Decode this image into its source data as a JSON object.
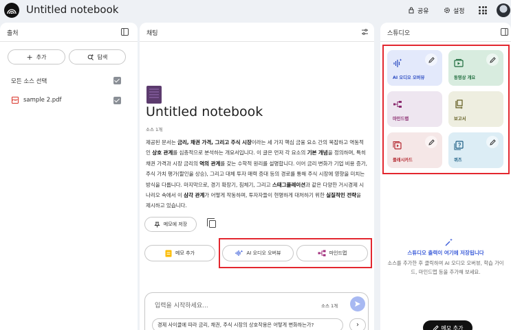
{
  "app": {
    "notebook_title": "Untitled notebook"
  },
  "topbar": {
    "share_label": "공유",
    "settings_label": "설정"
  },
  "sources": {
    "title": "출처",
    "add_label": "추가",
    "discover_label": "탐색",
    "select_all_label": "모든 소스 선택",
    "items": [
      {
        "name": "sample 2.pdf",
        "icon": "pdf-icon"
      }
    ]
  },
  "chat": {
    "title": "채팅",
    "notebook_title": "Untitled notebook",
    "source_count": "소스 1개",
    "summary_parts": [
      {
        "t": "제공된 문서는 ",
        "b": false
      },
      {
        "t": "금리, 채권 가격, 그리고 주식 시장",
        "b": true
      },
      {
        "t": "이라는 세 가지 핵심 금융 요소 간의 복잡하고 역동적인 ",
        "b": false
      },
      {
        "t": "상호 관계",
        "b": true
      },
      {
        "t": "를 심층적으로 분석하는 개요서입니다. 이 글은 먼저 각 요소의 ",
        "b": false
      },
      {
        "t": "기본 개념",
        "b": true
      },
      {
        "t": "을 정의하며, 특히 채권 가격과 시장 금리의 ",
        "b": false
      },
      {
        "t": "역의 관계",
        "b": true
      },
      {
        "t": "를 갖는 수학적 원리를 설명합니다. 이어 금리 변화가 기업 비용 증가, 주식 가치 평가(할인율 상승), 그리고 대체 투자 매력 증대 등의 경로를 통해 주식 시장에 영향을 미치는 방식을 다룹니다. 마지막으로, 경기 확장기, 침체기, 그리고 ",
        "b": false
      },
      {
        "t": "스태그플레이션",
        "b": true
      },
      {
        "t": "과 같은 다양한 거시경제 시나리오 속에서 이 ",
        "b": false
      },
      {
        "t": "삼각 관계",
        "b": true
      },
      {
        "t": "가 어떻게 작동하며, 투자자들이 현명하게 대처하기 위한 ",
        "b": false
      },
      {
        "t": "실질적인 전략",
        "b": true
      },
      {
        "t": "을 제시하고 있습니다.",
        "b": false
      }
    ],
    "save_memo_label": "메모에 저장",
    "add_memo_label": "메모 추가",
    "audio_overview_label": "AI 오디오 오버뷰",
    "mindmap_label": "마인드맵",
    "input": {
      "placeholder": "입력을 시작하세요...",
      "source_count": "소스 1개",
      "suggestion": "경제 사이클에 따라 금리, 채권, 주식 시장의 상호작용은 어떻게 변화하는가?"
    }
  },
  "studio": {
    "title": "스튜디오",
    "cards": [
      {
        "label": "AI 오디오 오버뷰",
        "icon": "audio-icon",
        "color": "#e3e9fb",
        "text_color": "#2b4bc2",
        "has_edit": true
      },
      {
        "label": "동영상 개요",
        "icon": "video-icon",
        "color": "#d8ecdf",
        "text_color": "#1b6a3a",
        "has_edit": true
      },
      {
        "label": "마인드맵",
        "icon": "mindmap-icon",
        "color": "#eee6f0",
        "text_color": "#8a2a6e",
        "has_edit": false
      },
      {
        "label": "보고서",
        "icon": "report-icon",
        "color": "#eeeee0",
        "text_color": "#5f5a1c",
        "has_edit": false
      },
      {
        "label": "플래시카드",
        "icon": "flashcard-icon",
        "color": "#f5e7e7",
        "text_color": "#b3262e",
        "has_edit": true
      },
      {
        "label": "퀴즈",
        "icon": "quiz-icon",
        "color": "#dcedf5",
        "text_color": "#1a5d83",
        "has_edit": true
      }
    ],
    "empty_title": "스튜디오 출력이 여기에 저장됩니다",
    "empty_desc": "소스를 추가한 후 클릭하여 AI 오디오 오버뷰, 학습 가이드, 마인드맵 등을 추가해 보세요.",
    "add_memo_label": "메모 추가"
  }
}
